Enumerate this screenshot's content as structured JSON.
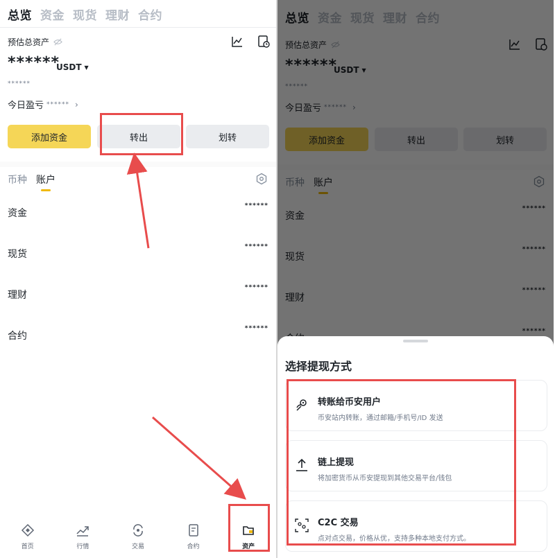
{
  "tabs": [
    "总览",
    "资金",
    "现货",
    "理财",
    "合约"
  ],
  "header": {
    "est_label": "预估总资产",
    "masked_total": "******",
    "currency": "USDT",
    "masked_sub": "******",
    "pnl_label": "今日盈亏",
    "pnl_value": "******"
  },
  "actions": {
    "add_funds": "添加资金",
    "withdraw": "转出",
    "transfer": "划转"
  },
  "subtabs": [
    "币种",
    "账户"
  ],
  "accounts": [
    {
      "name": "资金",
      "value": "******"
    },
    {
      "name": "现货",
      "value": "******"
    },
    {
      "name": "理财",
      "value": "******"
    },
    {
      "name": "合约",
      "value": "******"
    }
  ],
  "bottom_nav": [
    "首页",
    "行情",
    "交易",
    "合约",
    "资产"
  ],
  "sheet": {
    "title": "选择提现方式",
    "options": [
      {
        "title": "转账给币安用户",
        "desc": "币安站内转账，通过邮箱/手机号/ID 发送",
        "icon": "send-user-icon"
      },
      {
        "title": "链上提现",
        "desc": "将加密货币从币安提现到其他交易平台/钱包",
        "icon": "upload-icon"
      },
      {
        "title": "C2C 交易",
        "desc": "点对点交易，价格从优，支持多种本地支付方式。",
        "icon": "c2c-icon"
      }
    ]
  },
  "colors": {
    "brand_yellow": "#f5d657",
    "highlight_red": "#e84c4c"
  }
}
